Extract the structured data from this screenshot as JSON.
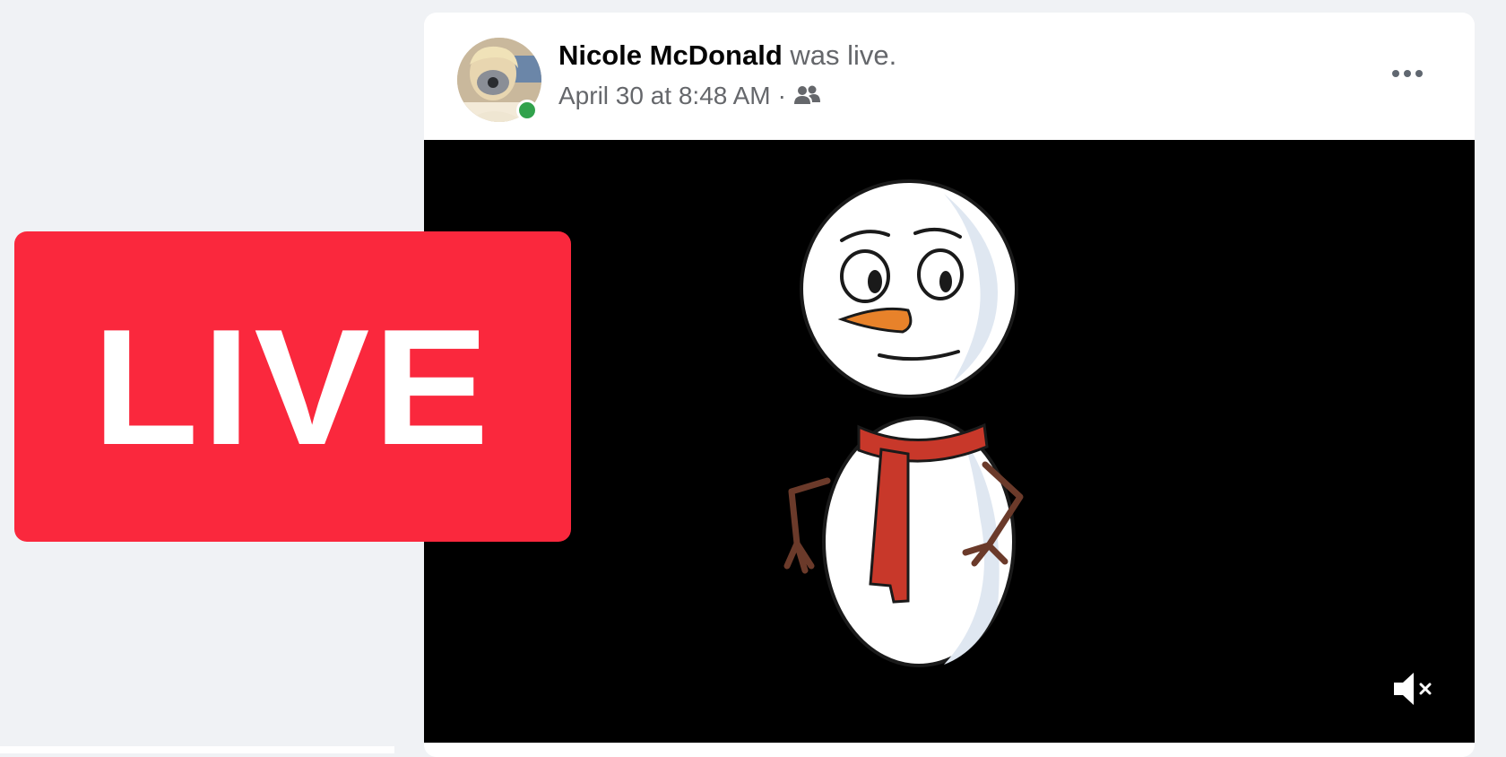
{
  "post": {
    "author_name": "Nicole McDonald",
    "action_text": "was live.",
    "timestamp": "April 30 at 8:48 AM",
    "separator": "·",
    "audience_icon": "friends-icon",
    "more_icon": "more-options-icon"
  },
  "video": {
    "mute_icon": "muted-speaker-icon",
    "content": "snowman-animation"
  },
  "live_badge": {
    "label": "LIVE"
  },
  "colors": {
    "page_bg": "#f0f2f5",
    "live_red": "#fa283d",
    "presence_green": "#31a24c",
    "scarf_red": "#c8382a",
    "nose_orange": "#e8822a",
    "arm_brown": "#6b3a2a"
  }
}
